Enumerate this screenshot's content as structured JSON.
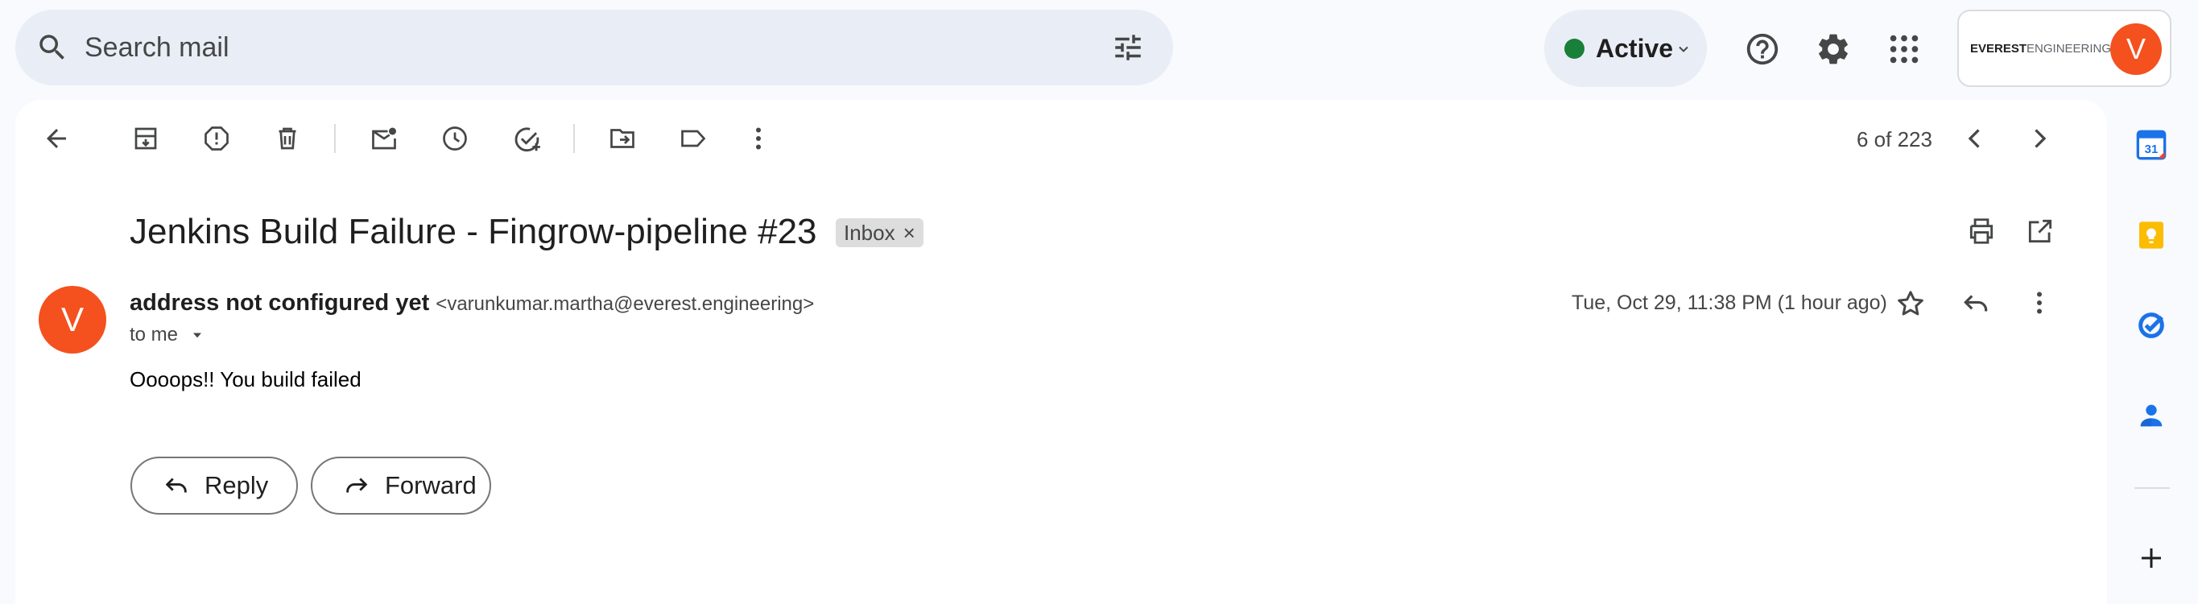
{
  "search": {
    "placeholder": "Search mail",
    "icon": "search-icon",
    "options_icon": "tune-icon"
  },
  "status": {
    "label": "Active",
    "color": "#188038"
  },
  "header_icons": [
    "help-icon",
    "settings-icon",
    "apps-icon"
  ],
  "account": {
    "logo_text_bold": "EVEREST",
    "logo_text_light": "ENGINEERING",
    "avatar_letter": "V",
    "avatar_color": "#f4511e"
  },
  "toolbar": {
    "back": "back-arrow-icon",
    "actions": [
      "archive-icon",
      "report-spam-icon",
      "delete-icon",
      "mark-unread-icon",
      "snooze-icon",
      "add-task-icon",
      "move-to-icon",
      "label-icon",
      "more-vert-icon"
    ],
    "pager": "6 of 223"
  },
  "email": {
    "subject": "Jenkins Build Failure - Fingrow-pipeline #23",
    "label": "Inbox",
    "label_remove": "×",
    "sender_name": "address not configured yet",
    "sender_email": "<varunkumar.martha@everest.engineering>",
    "avatar_letter": "V",
    "to": "to me",
    "date": "Tue, Oct 29, 11:38 PM (1 hour ago)",
    "body": "Oooops!! You build failed"
  },
  "actions": {
    "reply": "Reply",
    "forward": "Forward"
  },
  "side_panel": {
    "items": [
      "calendar-icon",
      "keep-icon",
      "tasks-icon",
      "contacts-icon"
    ],
    "calendar_day": "31",
    "add": "add-icon"
  }
}
